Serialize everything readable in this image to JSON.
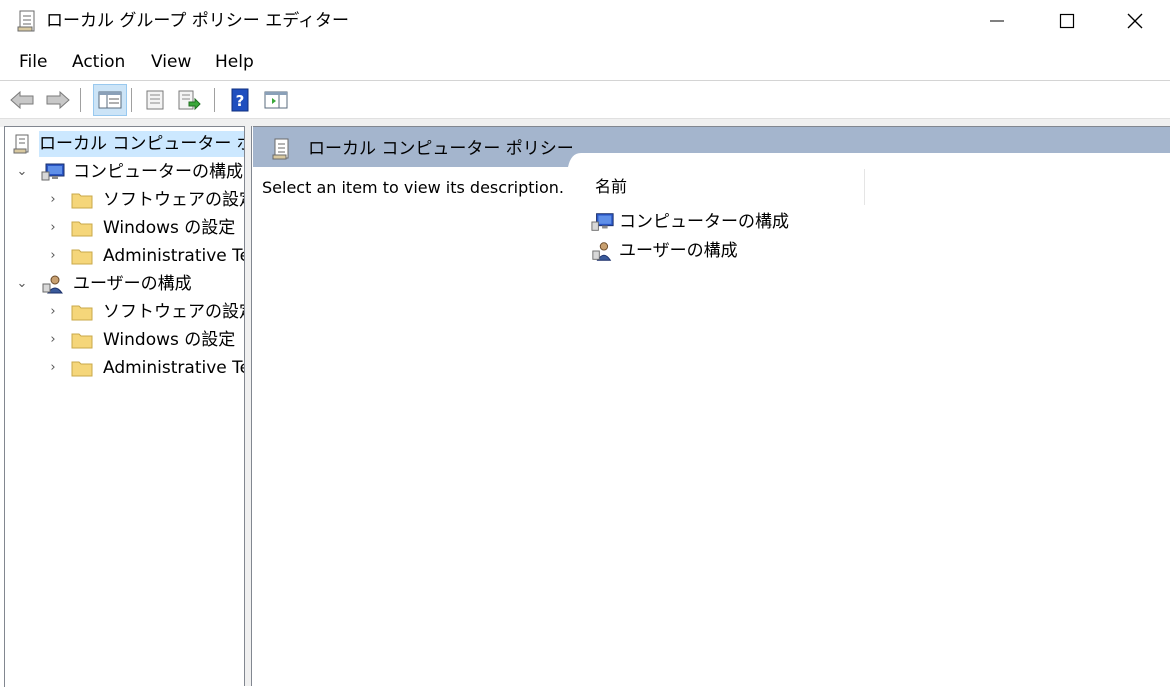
{
  "window": {
    "title": "ローカル グループ ポリシー エディター",
    "controls": {
      "minimize": "—",
      "maximize": "☐",
      "close": "✕"
    }
  },
  "menu": [
    "File",
    "Action",
    "View",
    "Help"
  ],
  "toolbar": {
    "buttons": [
      "back-icon",
      "forward-icon",
      "show-hide-tree-icon",
      "properties-icon",
      "export-list-icon",
      "help-icon",
      "show-hide-action-pane-icon"
    ]
  },
  "tree": {
    "root": "ローカル コンピューター ポリシ",
    "computer": {
      "label": "コンピューターの構成",
      "children": [
        "ソフトウェアの設定",
        "Windows の設定",
        "Administrative Te"
      ]
    },
    "user": {
      "label": "ユーザーの構成",
      "children": [
        "ソフトウェアの設定",
        "Windows の設定",
        "Administrative Te"
      ]
    }
  },
  "details": {
    "header_title": "ローカル コンピューター ポリシー",
    "description": "Select an item to view its description.",
    "column_name": "名前",
    "items": [
      "コンピューターの構成",
      "ユーザーの構成"
    ]
  },
  "colors": {
    "header_band": "#a4b5cd",
    "selection": "#cce8ff",
    "folder": "#f5d67a"
  }
}
